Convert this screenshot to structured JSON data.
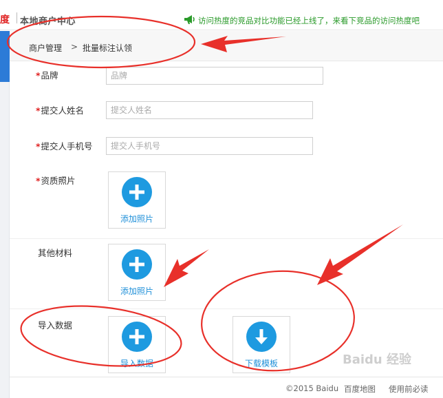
{
  "header": {
    "logo_text": "度",
    "app_title": "本地商户中心",
    "notice": "访问热度的竞品对比功能已经上线了，来看下竞品的访问热度吧"
  },
  "breadcrumb": {
    "items": [
      "商户管理",
      "批量标注认领"
    ],
    "separator": ">"
  },
  "form": {
    "required_mark": "*",
    "brand": {
      "label": "品牌",
      "placeholder": "品牌"
    },
    "submitter_name": {
      "label": "提交人姓名",
      "placeholder": "提交人姓名"
    },
    "submitter_phone": {
      "label": "提交人手机号",
      "placeholder": "提交人手机号"
    },
    "qualification": {
      "label": "资质照片",
      "button": "添加照片"
    },
    "other": {
      "label": "其他材料",
      "button": "添加照片"
    },
    "import": {
      "label": "导入数据",
      "button": "导入数据",
      "download_button": "下载模板"
    }
  },
  "footer": {
    "copyright": "©2015 Baidu",
    "map_link": "百度地图",
    "guide_link": "使用前必读"
  },
  "watermark": "Baidu 经验",
  "colors": {
    "accent": "#1e9ae0",
    "required": "#e02020",
    "notice": "#2a9a2a",
    "annotation": "#e8302a"
  },
  "icons": [
    "megaphone-icon",
    "plus-icon",
    "download-icon"
  ]
}
